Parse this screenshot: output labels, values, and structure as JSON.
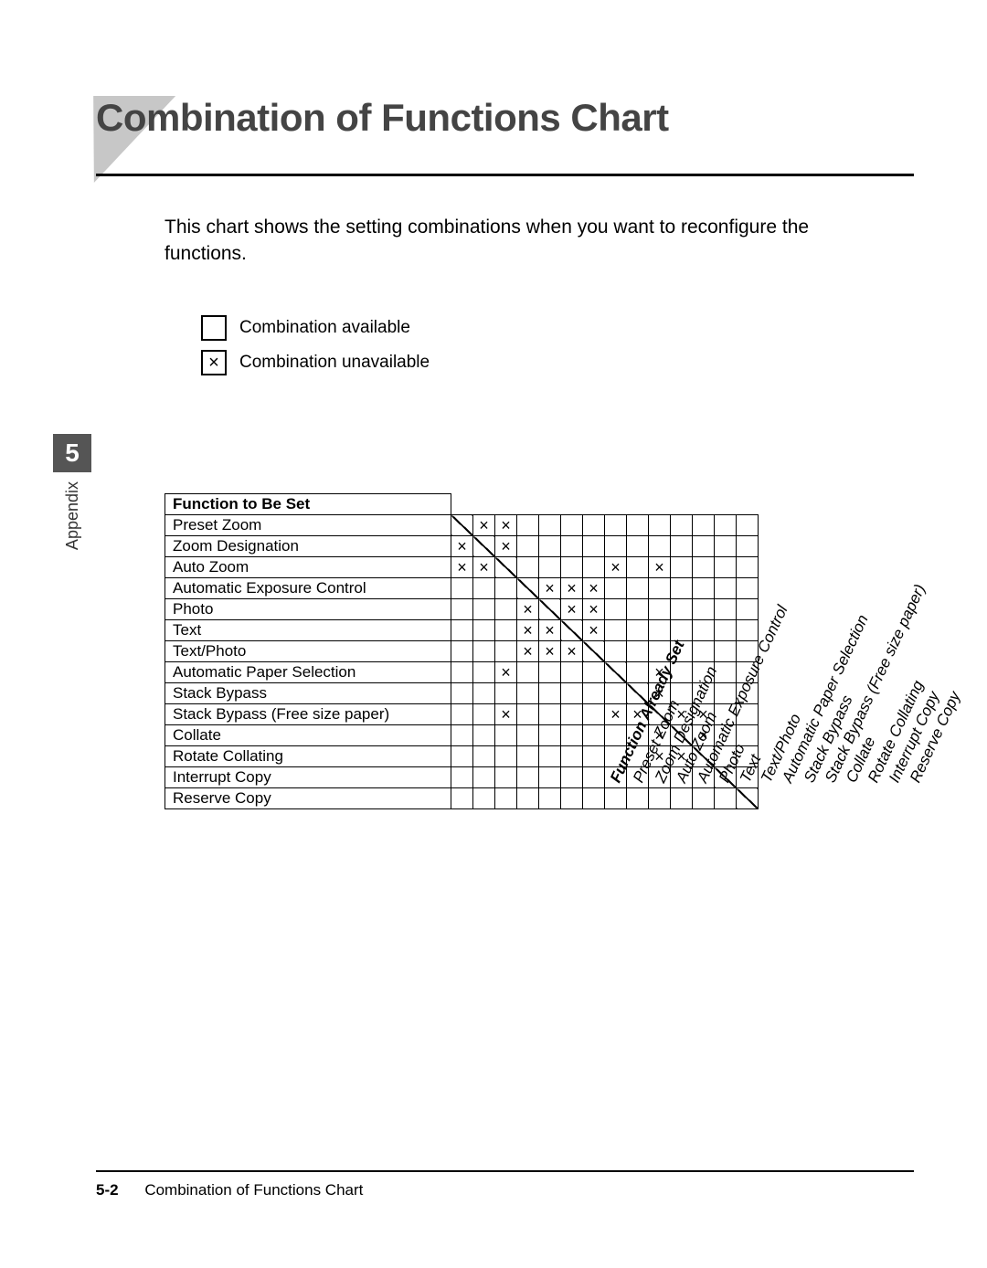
{
  "title_main": "Combination of Functions Chart",
  "intro": "This chart shows the setting combinations when you want to reconfigure the functions.",
  "legend": {
    "available": "Combination available",
    "unavailable": "Combination unavailable",
    "x_mark": "×"
  },
  "sidebar": {
    "num": "5",
    "label": "Appendix"
  },
  "footer": {
    "page": "5-2",
    "title": "Combination of Functions Chart"
  },
  "columns_title": "Function Already Set",
  "rows_title": "Function to Be Set",
  "columns": [
    "Preset Zoom",
    "Zoom Designation",
    "Auto Zoom",
    "Automatic Exposure Control",
    "Photo",
    "Text",
    "Text/Photo",
    "Automatic Paper Selection",
    "Stack Bypass",
    "Stack Bypass (Free size paper)",
    "Collate",
    "Rotate Collating",
    "Interrupt Copy",
    "Reserve Copy"
  ],
  "chart_data": {
    "type": "table",
    "title": "Combination of Functions Chart",
    "x_axis": "Function Already Set",
    "y_axis": "Function to Be Set",
    "legend": {
      "x": "Combination unavailable",
      "blank": "Combination available"
    },
    "columns": [
      "Preset Zoom",
      "Zoom Designation",
      "Auto Zoom",
      "Automatic Exposure Control",
      "Photo",
      "Text",
      "Text/Photo",
      "Automatic Paper Selection",
      "Stack Bypass",
      "Stack Bypass (Free size paper)",
      "Collate",
      "Rotate Collating",
      "Interrupt Copy",
      "Reserve Copy"
    ],
    "rows": [
      {
        "label": "Preset Zoom",
        "cells": [
          "d",
          "x",
          "x",
          "",
          "",
          "",
          "",
          "",
          "",
          "",
          "",
          "",
          "",
          ""
        ]
      },
      {
        "label": "Zoom Designation",
        "cells": [
          "x",
          "d",
          "x",
          "",
          "",
          "",
          "",
          "",
          "",
          "",
          "",
          "",
          "",
          ""
        ]
      },
      {
        "label": "Auto Zoom",
        "cells": [
          "x",
          "x",
          "d",
          "",
          "",
          "",
          "",
          "x",
          "",
          "x",
          "",
          "",
          "",
          ""
        ]
      },
      {
        "label": "Automatic Exposure Control",
        "cells": [
          "",
          "",
          "",
          "d",
          "x",
          "x",
          "x",
          "",
          "",
          "",
          "",
          "",
          "",
          ""
        ]
      },
      {
        "label": "Photo",
        "cells": [
          "",
          "",
          "",
          "x",
          "d",
          "x",
          "x",
          "",
          "",
          "",
          "",
          "",
          "",
          ""
        ]
      },
      {
        "label": "Text",
        "cells": [
          "",
          "",
          "",
          "x",
          "x",
          "d",
          "x",
          "",
          "",
          "",
          "",
          "",
          "",
          ""
        ]
      },
      {
        "label": "Text/Photo",
        "cells": [
          "",
          "",
          "",
          "x",
          "x",
          "x",
          "d",
          "",
          "",
          "",
          "",
          "",
          "",
          ""
        ]
      },
      {
        "label": "Automatic Paper Selection",
        "cells": [
          "",
          "",
          "x",
          "",
          "",
          "",
          "",
          "d",
          "",
          "x",
          "",
          "",
          "",
          ""
        ]
      },
      {
        "label": "Stack Bypass",
        "cells": [
          "",
          "",
          "",
          "",
          "",
          "",
          "",
          "",
          "d",
          "x",
          "",
          "",
          "",
          ""
        ]
      },
      {
        "label": "Stack Bypass (Free size paper)",
        "cells": [
          "",
          "",
          "x",
          "",
          "",
          "",
          "",
          "x",
          "x",
          "d",
          "x",
          "x",
          "",
          ""
        ]
      },
      {
        "label": "Collate",
        "cells": [
          "",
          "",
          "",
          "",
          "",
          "",
          "",
          "",
          "",
          "x",
          "d",
          "x",
          "",
          ""
        ]
      },
      {
        "label": "Rotate Collating",
        "cells": [
          "",
          "",
          "",
          "",
          "",
          "",
          "",
          "",
          "",
          "x",
          "x",
          "d",
          "",
          ""
        ]
      },
      {
        "label": "Interrupt Copy",
        "cells": [
          "",
          "",
          "",
          "",
          "",
          "",
          "",
          "",
          "",
          "",
          "",
          "",
          "d",
          ""
        ]
      },
      {
        "label": "Reserve Copy",
        "cells": [
          "",
          "",
          "",
          "",
          "",
          "",
          "",
          "",
          "",
          "",
          "",
          "",
          "",
          "d"
        ]
      }
    ]
  }
}
